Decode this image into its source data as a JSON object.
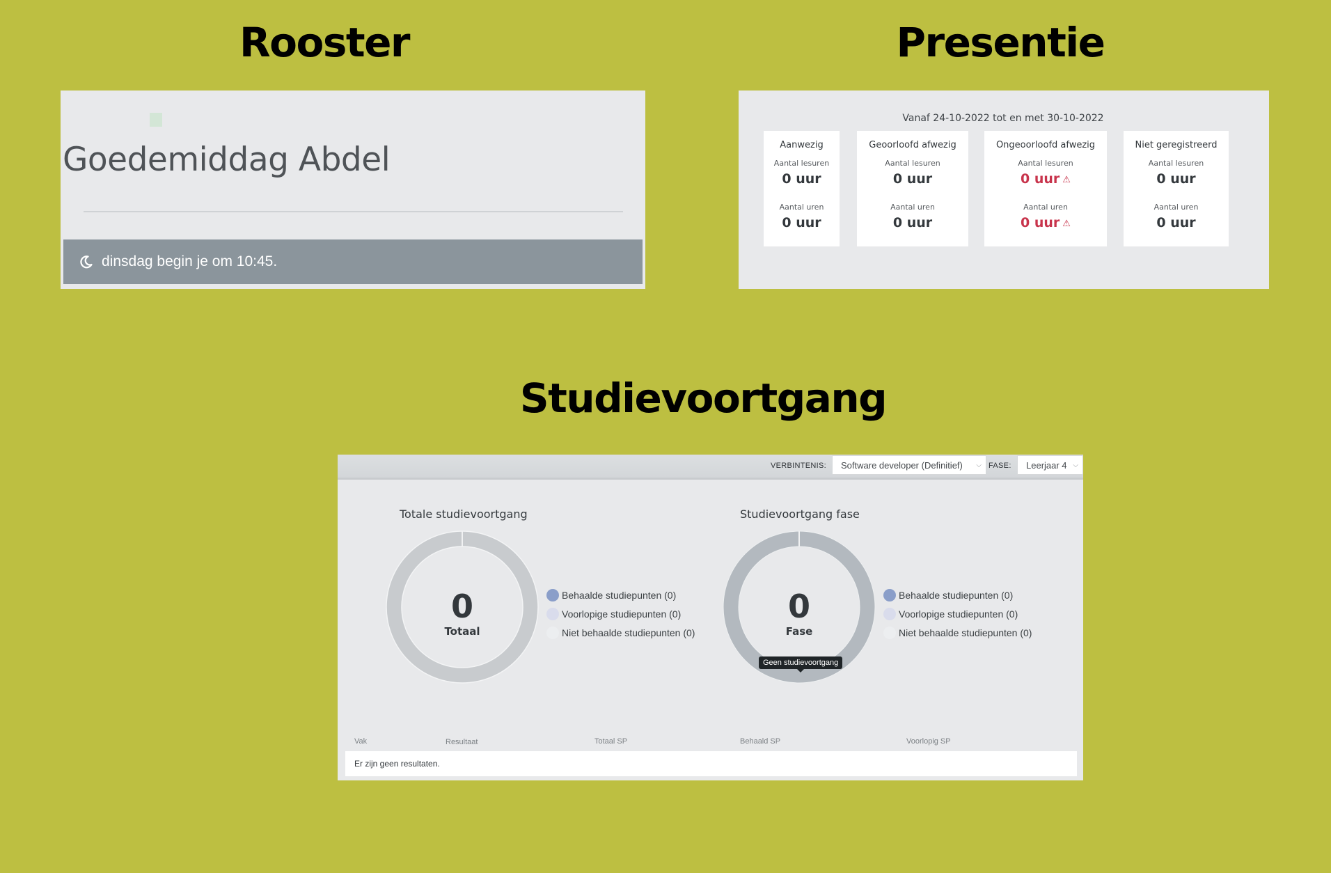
{
  "sections": {
    "rooster": "Rooster",
    "presentie": "Presentie",
    "studievoortgang": "Studievoortgang"
  },
  "rooster": {
    "greeting": "Goedemiddag Abdel",
    "banner_text": "dinsdag begin je om 10:45.",
    "banner_icon": "moon-icon"
  },
  "presentie": {
    "period": "Vanaf 24-10-2022 tot en met 30-10-2022",
    "cards": [
      {
        "title": "Aanwezig",
        "label1": "Aantal lesuren",
        "value1": "0 uur",
        "label2": "Aantal uren",
        "value2": "0 uur",
        "alert": false
      },
      {
        "title": "Geoorloofd afwezig",
        "label1": "Aantal lesuren",
        "value1": "0 uur",
        "label2": "Aantal uren",
        "value2": "0 uur",
        "alert": false
      },
      {
        "title": "Ongeoorloofd afwezig",
        "label1": "Aantal lesuren",
        "value1": "0 uur",
        "label2": "Aantal uren",
        "value2": "0 uur",
        "alert": true
      },
      {
        "title": "Niet geregistreerd",
        "label1": "Aantal lesuren",
        "value1": "0 uur",
        "label2": "Aantal uren",
        "value2": "0 uur",
        "alert": false
      }
    ],
    "alert_color": "#c8344c"
  },
  "studievoortgang": {
    "filters": {
      "verbintenis_label": "VERBINTENIS:",
      "verbintenis_value": "Software developer (Definitief)",
      "fase_label": "FASE:",
      "fase_value": "Leerjaar 4"
    },
    "charts": [
      {
        "title": "Totale studievoortgang",
        "value": "0",
        "sublabel": "Totaal",
        "legend": [
          "Behaalde studiepunten (0)",
          "Voorlopige studiepunten (0)",
          "Niet behaalde studiepunten (0)"
        ]
      },
      {
        "title": "Studievoortgang fase",
        "value": "0",
        "sublabel": "Fase",
        "legend": [
          "Behaalde studiepunten (0)",
          "Voorlopige studiepunten (0)",
          "Niet behaalde studiepunten (0)"
        ],
        "tooltip": "Geen studievoortgang"
      }
    ],
    "legend_colors": [
      "#8a9ec9",
      "#d9dcec",
      "#eceef0"
    ],
    "table": {
      "headers": [
        "Vak",
        "Resultaat",
        "Totaal SP",
        "Behaald SP",
        "Voorlopig SP"
      ],
      "empty_text": "Er zijn geen resultaten."
    }
  }
}
